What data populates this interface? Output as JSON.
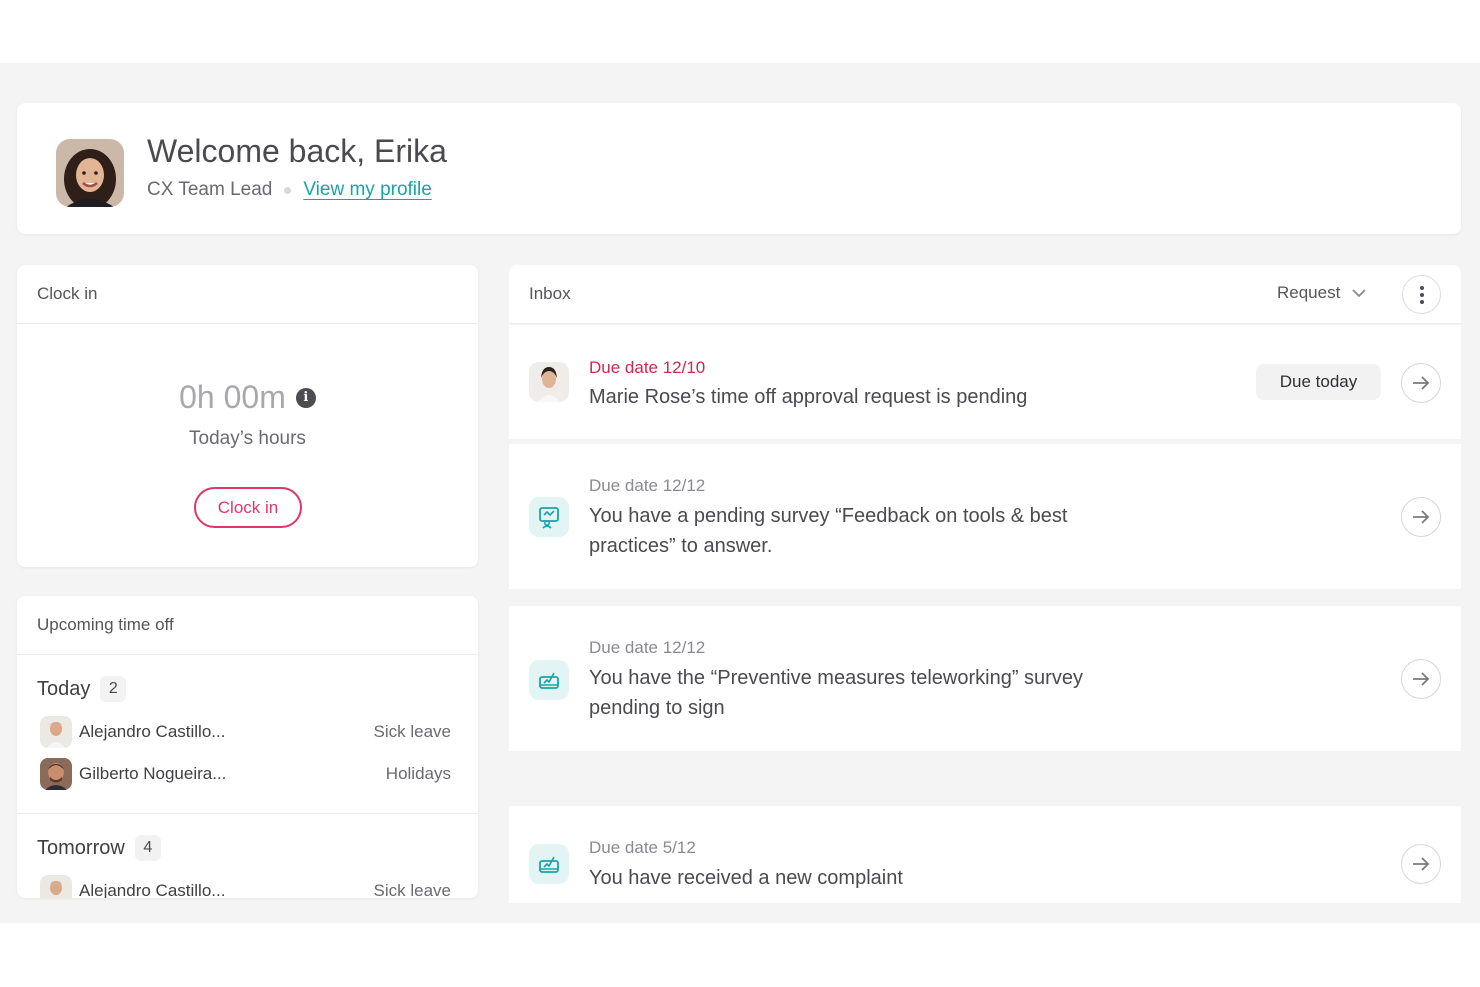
{
  "welcome": {
    "title": "Welcome back, Erika",
    "role": "CX Team Lead",
    "profile_link": "View my profile"
  },
  "clock_in": {
    "header": "Clock in",
    "hours": "0h 00m",
    "hours_label": "Today’s hours",
    "button": "Clock in"
  },
  "time_off": {
    "header": "Upcoming time off",
    "groups": [
      {
        "label": "Today",
        "count": "2",
        "people": [
          {
            "name": "Alejandro Castillo...",
            "type": "Sick leave"
          },
          {
            "name": "Gilberto Nogueira...",
            "type": "Holidays"
          }
        ]
      },
      {
        "label": "Tomorrow",
        "count": "4",
        "people": [
          {
            "name": "Alejandro Castillo...",
            "type": "Sick leave"
          }
        ]
      }
    ]
  },
  "inbox": {
    "title": "Inbox",
    "filter": "Request",
    "items": [
      {
        "due": "Due date 12/10",
        "message": "Marie Rose’s time off approval request is pending",
        "badge": "Due today",
        "icon": "user-avatar"
      },
      {
        "due": "Due date 12/12",
        "message": "You have a pending survey “Feedback on tools & best practices” to answer.",
        "icon": "survey-icon"
      },
      {
        "due": "Due date 12/12",
        "message": "You have the “Preventive measures teleworking” survey pending to sign",
        "icon": "sign-document-icon"
      },
      {
        "due": "Due date 5/12",
        "message": "You have received a new complaint",
        "icon": "complaint-icon"
      }
    ]
  },
  "colors": {
    "accent_teal": "#1aa3a8",
    "accent_red": "#e0366a",
    "due_red": "#d0284f",
    "background": "#f4f4f4"
  }
}
